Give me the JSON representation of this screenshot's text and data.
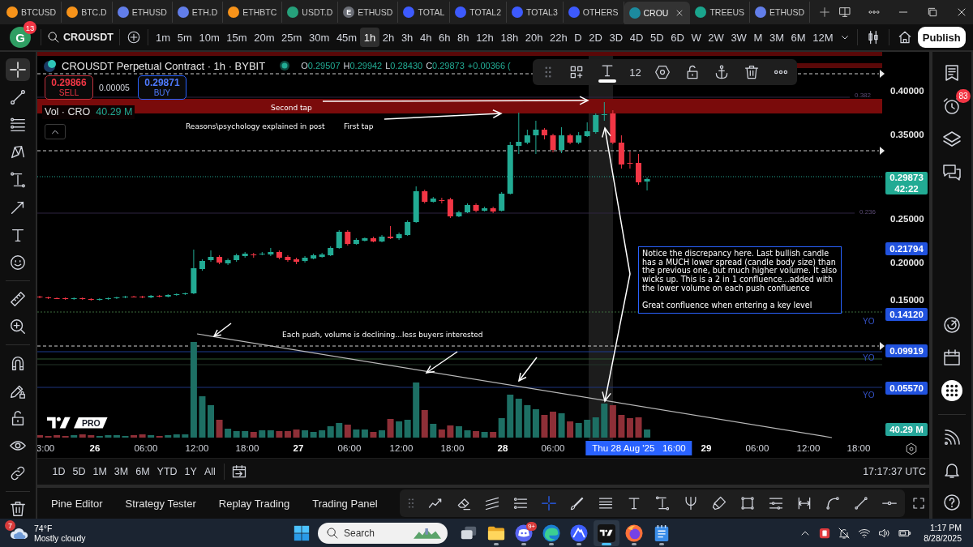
{
  "browser": {
    "tabs": [
      {
        "label": "BTCUSD",
        "color": "#f7931a",
        "selected": false
      },
      {
        "label": "BTC.D",
        "color": "#f7931a",
        "selected": false
      },
      {
        "label": "ETHUSD",
        "color": "#627eea",
        "selected": false
      },
      {
        "label": "ETH.D",
        "color": "#627eea",
        "selected": false
      },
      {
        "label": "ETHBTC",
        "color": "#f7931a",
        "selected": false
      },
      {
        "label": "USDT.D",
        "color": "#26a17b",
        "selected": false
      },
      {
        "label": "ETHUSD",
        "color": "#6b6e76",
        "letter": "E",
        "selected": false
      },
      {
        "label": "TOTAL",
        "color": "#3d5afe",
        "selected": false
      },
      {
        "label": "TOTAL2",
        "color": "#3d5afe",
        "selected": false
      },
      {
        "label": "TOTAL3",
        "color": "#3d5afe",
        "selected": false
      },
      {
        "label": "OTHERS",
        "color": "#3d5afe",
        "selected": false
      },
      {
        "label": "CROU",
        "color": "#1c8a9e",
        "selected": true
      },
      {
        "label": "TREEUS",
        "color": "#1aa58d",
        "selected": false
      },
      {
        "label": "ETHUSD",
        "color": "#627eea",
        "selected": false
      }
    ]
  },
  "tv_toolbar": {
    "avatar": "G",
    "badge": "13",
    "symbol": "CROUSDT",
    "intervals": [
      {
        "label": "1m",
        "selected": false
      },
      {
        "label": "5m",
        "selected": false
      },
      {
        "label": "10m",
        "selected": false
      },
      {
        "label": "15m",
        "selected": false
      },
      {
        "label": "20m",
        "selected": false
      },
      {
        "label": "25m",
        "selected": false
      },
      {
        "label": "30m",
        "selected": false
      },
      {
        "label": "45m",
        "selected": false
      },
      {
        "label": "1h",
        "selected": true
      },
      {
        "label": "2h",
        "selected": false
      },
      {
        "label": "3h",
        "selected": false
      },
      {
        "label": "4h",
        "selected": false
      },
      {
        "label": "6h",
        "selected": false
      },
      {
        "label": "8h",
        "selected": false
      },
      {
        "label": "12h",
        "selected": false
      },
      {
        "label": "18h",
        "selected": false
      },
      {
        "label": "20h",
        "selected": false
      },
      {
        "label": "22h",
        "selected": false
      },
      {
        "label": "D",
        "selected": false
      },
      {
        "label": "2D",
        "selected": false
      },
      {
        "label": "3D",
        "selected": false
      },
      {
        "label": "4D",
        "selected": false
      },
      {
        "label": "5D",
        "selected": false
      },
      {
        "label": "6D",
        "selected": false
      },
      {
        "label": "W",
        "selected": false
      },
      {
        "label": "2W",
        "selected": false
      },
      {
        "label": "3W",
        "selected": false
      },
      {
        "label": "M",
        "selected": false
      },
      {
        "label": "3M",
        "selected": false
      },
      {
        "label": "6M",
        "selected": false
      },
      {
        "label": "12M",
        "selected": false
      }
    ],
    "publish": "Publish"
  },
  "left_toolbar": [
    [
      {
        "kind": "crosshair",
        "selected": true
      },
      {
        "kind": "trend-line",
        "selected": false
      },
      {
        "kind": "level-lines",
        "selected": false
      },
      {
        "kind": "zigzag-pattern",
        "selected": false
      },
      {
        "kind": "vertical-measure",
        "selected": false
      },
      {
        "kind": "arrow-line",
        "selected": false
      },
      {
        "kind": "text",
        "selected": false
      },
      {
        "kind": "smiley",
        "selected": false
      }
    ],
    [
      {
        "kind": "ruler",
        "selected": false
      },
      {
        "kind": "zoom-in",
        "selected": false
      }
    ],
    [
      {
        "kind": "magnet",
        "selected": false
      },
      {
        "kind": "pencil-lock",
        "selected": false
      },
      {
        "kind": "lock",
        "selected": false
      },
      {
        "kind": "eye",
        "selected": false
      },
      {
        "kind": "link",
        "selected": false
      }
    ],
    [
      {
        "kind": "trash",
        "selected": false
      }
    ]
  ],
  "chart": {
    "legend": {
      "title": "CROUSDT Perpetual Contract · 1h · BYBIT",
      "ohlc": [
        {
          "key": "O",
          "value": "0.29507"
        },
        {
          "key": "H",
          "value": "0.29942"
        },
        {
          "key": "L",
          "value": "0.28430"
        },
        {
          "key": "C",
          "value": "0.29873"
        }
      ],
      "change": "+0.00366 ("
    },
    "order": {
      "sell_price": "0.29866",
      "sell_label": "SELL",
      "spread": "0.00005",
      "buy_price": "0.29871",
      "buy_label": "BUY"
    },
    "volume_legend": {
      "label": "Vol · CRO",
      "value": "40.29 M"
    },
    "drawing_toolbar": {
      "font_size": "12"
    },
    "annotations": [
      "Second tap",
      "Reasons\\psychology explained in post",
      "First tap",
      "Each push, volume is declining...less buyers interested"
    ],
    "note": [
      "Notice the discrepancy here. Last bullish candle has a MUCH lower spread (candle body size) than the previous one, but much higher volume. It also wicks up. This is a 2 in 1 confluence...added with the lower volume on each push confluence",
      "Great confluence when entering a key level"
    ],
    "fib_labels": [
      "0.382",
      "0.236"
    ],
    "level_tags": [
      "YO",
      "YO",
      "YO"
    ],
    "price_axis": [
      {
        "kind": "tick",
        "label": "0.40000"
      },
      {
        "kind": "tick",
        "label": "0.35000"
      },
      {
        "kind": "last",
        "label": "0.29873",
        "sub": "42:22"
      },
      {
        "kind": "tick",
        "label": "0.25000"
      },
      {
        "kind": "level",
        "label": "0.21794"
      },
      {
        "kind": "tick",
        "label": "0.20000"
      },
      {
        "kind": "tick",
        "label": "0.15000"
      },
      {
        "kind": "level",
        "label": "0.14120"
      },
      {
        "kind": "level",
        "label": "0.09919"
      },
      {
        "kind": "level",
        "label": "0.05570"
      },
      {
        "kind": "volume",
        "label": "40.29 M"
      }
    ],
    "time_axis": [
      {
        "kind": "time",
        "label": "3:00"
      },
      {
        "kind": "day",
        "label": "26"
      },
      {
        "kind": "time",
        "label": "06:00"
      },
      {
        "kind": "time",
        "label": "12:00"
      },
      {
        "kind": "time",
        "label": "18:00"
      },
      {
        "kind": "day",
        "label": "27"
      },
      {
        "kind": "time",
        "label": "06:00"
      },
      {
        "kind": "time",
        "label": "12:00"
      },
      {
        "kind": "time",
        "label": "18:00"
      },
      {
        "kind": "day",
        "label": "28"
      },
      {
        "kind": "time",
        "label": "06:00"
      },
      {
        "kind": "cursor",
        "label": "Thu 28 Aug '25   16:00"
      },
      {
        "kind": "day",
        "label": "29"
      },
      {
        "kind": "time",
        "label": "06:00"
      },
      {
        "kind": "time",
        "label": "12:00"
      },
      {
        "kind": "time",
        "label": "18:00"
      }
    ],
    "watermark": {
      "badge": "PRO"
    }
  },
  "range_bar": {
    "ranges": [
      "1D",
      "5D",
      "1M",
      "3M",
      "6M",
      "YTD",
      "1Y",
      "All"
    ],
    "clock": "17:17:37 UTC"
  },
  "bottom_panel": {
    "tabs": [
      "Pine Editor",
      "Strategy Tester",
      "Replay Trading",
      "Trading Panel"
    ],
    "tools": [
      {
        "kind": "trend-zigzag",
        "selected": false
      },
      {
        "kind": "eraser",
        "selected": false
      },
      {
        "kind": "channel-lines",
        "selected": false
      },
      {
        "kind": "dotted-lines",
        "selected": false
      },
      {
        "kind": "crosshair",
        "selected": true
      },
      {
        "kind": "brush",
        "selected": false
      },
      {
        "kind": "stacked-lines",
        "selected": false
      },
      {
        "kind": "text",
        "selected": false
      },
      {
        "kind": "vertical-measure",
        "selected": false
      },
      {
        "kind": "pitchfork",
        "selected": false
      },
      {
        "kind": "highlighter",
        "selected": false
      },
      {
        "kind": "rectangle",
        "selected": false
      },
      {
        "kind": "dot-rows",
        "selected": false
      },
      {
        "kind": "range-measure",
        "selected": false
      },
      {
        "kind": "curve",
        "selected": false
      },
      {
        "kind": "line",
        "selected": false
      },
      {
        "kind": "dot-line",
        "selected": false
      }
    ]
  },
  "right_sidebar": {
    "alerts_badge": "83"
  },
  "taskbar": {
    "weather": {
      "badge": "7",
      "temperature": "74°F",
      "condition": "Mostly cloudy"
    },
    "search_placeholder": "Search",
    "apps": [
      {
        "kind": "task-view",
        "running": false,
        "active": false
      },
      {
        "kind": "folder",
        "running": true,
        "active": false
      },
      {
        "kind": "chat",
        "running": true,
        "active": false,
        "badge": "9+"
      },
      {
        "kind": "swirl",
        "running": true,
        "active": false
      },
      {
        "kind": "mountain",
        "running": true,
        "active": false
      },
      {
        "kind": "chart-logo",
        "running": true,
        "active": true
      },
      {
        "kind": "flame",
        "running": true,
        "active": false
      },
      {
        "kind": "notepad",
        "running": true,
        "active": false
      }
    ],
    "time": "1:17 PM",
    "date": "8/28/2025"
  }
}
